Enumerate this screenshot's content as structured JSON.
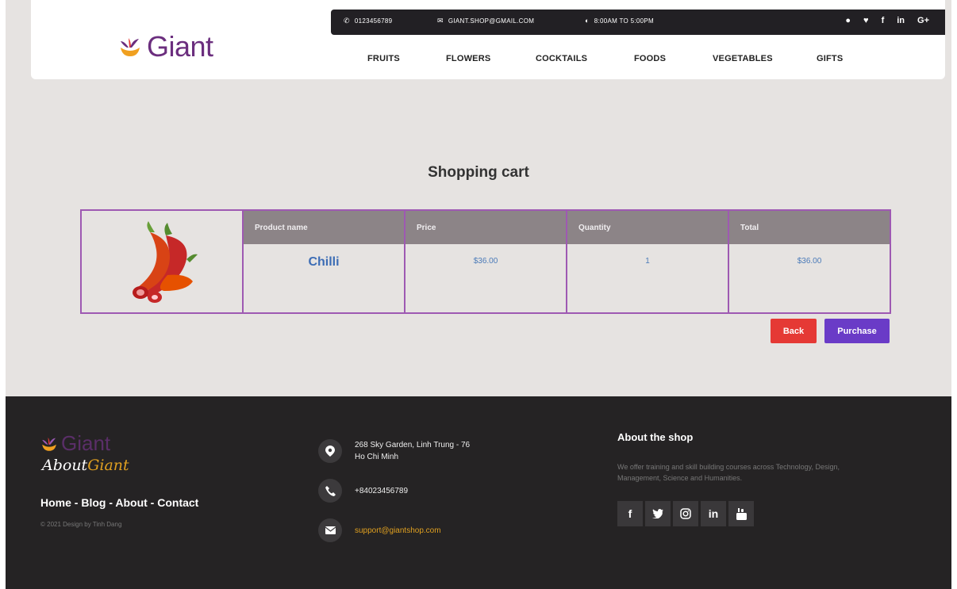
{
  "header": {
    "brand": "Giant",
    "topbar": {
      "phone": "0123456789",
      "email": "GIANT.SHOP@GMAIL.COM",
      "hours": "8:00AM TO 5:00PM",
      "social": [
        "user-icon",
        "twitter-icon",
        "facebook-icon",
        "linkedin-icon",
        "google-plus-icon"
      ]
    },
    "nav": [
      "FRUITS",
      "FLOWERS",
      "COCKTAILS",
      "FOODS",
      "VEGETABLES",
      "GIFTS"
    ]
  },
  "main": {
    "title": "Shopping cart",
    "columns": [
      "Product name",
      "Price",
      "Quantity",
      "Total"
    ],
    "item": {
      "name": "Chilli",
      "price": "$36.00",
      "quantity": "1",
      "total": "$36.00",
      "image": "chilli-image"
    },
    "buttons": {
      "back": "Back",
      "purchase": "Purchase"
    }
  },
  "footer": {
    "brand": "Giant",
    "about_prefix": "About",
    "about_accent": "Giant",
    "links": "Home - Blog - About - Contact",
    "copyright": "© 2021 Design by Tinh Dang",
    "address_line1": "268 Sky Garden, Linh Trung - 76",
    "address_line2": "Ho Chi Minh",
    "phone": "+84023456789",
    "email": "support@giantshop.com",
    "about_heading": "About the shop",
    "about_text": "We offer training and skill building courses across Technology, Design, Management, Science and Humanities.",
    "social": [
      "facebook-icon",
      "twitter-icon",
      "instagram-icon",
      "linkedin-icon",
      "youtube-icon"
    ]
  },
  "colors": {
    "brand_purple": "#6b2e7e",
    "accent_gold": "#e0a020",
    "cart_border": "#9e59b2",
    "back_button": "#e53935",
    "purchase_button": "#6a3bc7"
  }
}
